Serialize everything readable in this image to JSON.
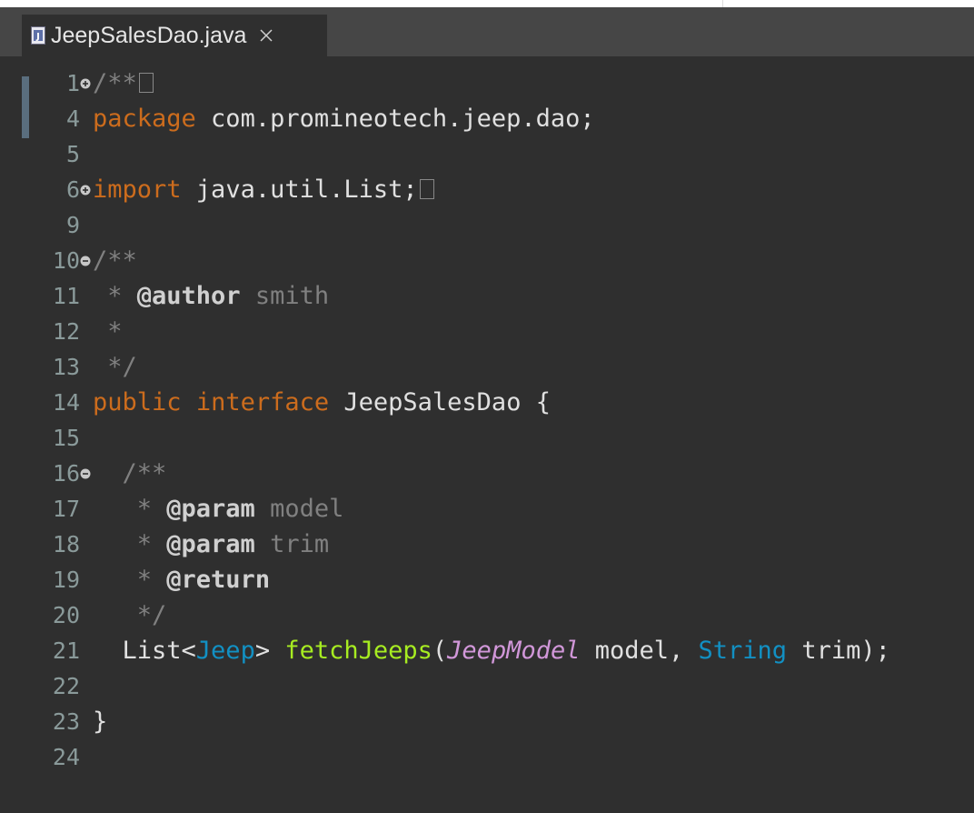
{
  "editor": {
    "tab": {
      "title": "JeepSalesDao.java",
      "close_icon": "close-icon",
      "file_icon": "java-file-icon"
    },
    "lines": [
      {
        "num": "1",
        "fold": "expand",
        "parts": [
          {
            "t": "cm",
            "v": "/**"
          }
        ],
        "collapsed": true
      },
      {
        "num": "4",
        "parts": [
          {
            "t": "kw",
            "v": "package"
          },
          {
            "t": "pl",
            "v": " com.promineotech.jeep.dao;"
          }
        ]
      },
      {
        "num": "5",
        "parts": []
      },
      {
        "num": "6",
        "fold": "expand",
        "parts": [
          {
            "t": "kw",
            "v": "import"
          },
          {
            "t": "pl",
            "v": " java.util.List;"
          }
        ],
        "collapsed": true
      },
      {
        "num": "9",
        "parts": []
      },
      {
        "num": "10",
        "fold": "collapse",
        "parts": [
          {
            "t": "cm",
            "v": "/**"
          }
        ]
      },
      {
        "num": "11",
        "parts": [
          {
            "t": "cm",
            "v": " * "
          },
          {
            "t": "tag",
            "v": "@author"
          },
          {
            "t": "cm",
            "v": " smith"
          }
        ]
      },
      {
        "num": "12",
        "parts": [
          {
            "t": "cm",
            "v": " *"
          }
        ]
      },
      {
        "num": "13",
        "parts": [
          {
            "t": "cm",
            "v": " */"
          }
        ]
      },
      {
        "num": "14",
        "parts": [
          {
            "t": "kw",
            "v": "public"
          },
          {
            "t": "pl",
            "v": " "
          },
          {
            "t": "kw",
            "v": "interface"
          },
          {
            "t": "pl",
            "v": " JeepSalesDao {"
          }
        ]
      },
      {
        "num": "15",
        "parts": []
      },
      {
        "num": "16",
        "fold": "collapse",
        "parts": [
          {
            "t": "cm",
            "v": "  /**"
          }
        ]
      },
      {
        "num": "17",
        "parts": [
          {
            "t": "cm",
            "v": "   * "
          },
          {
            "t": "tag",
            "v": "@param"
          },
          {
            "t": "cm",
            "v": " model"
          }
        ]
      },
      {
        "num": "18",
        "parts": [
          {
            "t": "cm",
            "v": "   * "
          },
          {
            "t": "tag",
            "v": "@param"
          },
          {
            "t": "cm",
            "v": " trim"
          }
        ]
      },
      {
        "num": "19",
        "parts": [
          {
            "t": "cm",
            "v": "   * "
          },
          {
            "t": "tag",
            "v": "@return"
          }
        ]
      },
      {
        "num": "20",
        "parts": [
          {
            "t": "cm",
            "v": "   */"
          }
        ]
      },
      {
        "num": "21",
        "parts": [
          {
            "t": "pl",
            "v": "  List<"
          },
          {
            "t": "tp",
            "v": "Jeep"
          },
          {
            "t": "pl",
            "v": "> "
          },
          {
            "t": "fn",
            "v": "fetchJeeps"
          },
          {
            "t": "pl",
            "v": "("
          },
          {
            "t": "it",
            "v": "JeepModel"
          },
          {
            "t": "pl",
            "v": " model, "
          },
          {
            "t": "tp",
            "v": "String"
          },
          {
            "t": "pl",
            "v": " trim);"
          }
        ]
      },
      {
        "num": "22",
        "parts": []
      },
      {
        "num": "23",
        "parts": [
          {
            "t": "pl",
            "v": "}"
          }
        ]
      },
      {
        "num": "24",
        "parts": []
      }
    ]
  },
  "colors": {
    "background": "#2f2f2f",
    "tabbar": "#464646",
    "keyword": "#cc6c1d",
    "comment": "#808080",
    "type": "#1290c3",
    "method": "#a7ec21",
    "italic_type": "#d197d9",
    "line_number": "#8a9a9a"
  }
}
